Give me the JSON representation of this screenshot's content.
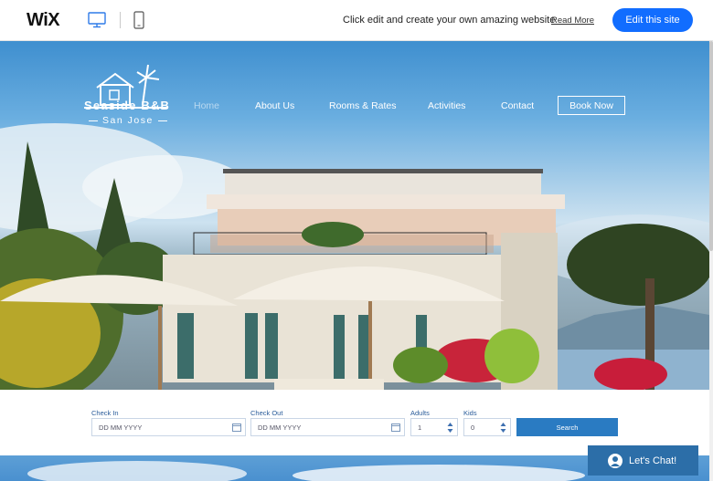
{
  "editor_bar": {
    "logo": "WiX",
    "promo_text": "Click edit and create your own amazing website",
    "read_more": "Read More",
    "edit_button": "Edit this site",
    "devices": [
      "desktop-icon",
      "mobile-icon"
    ]
  },
  "site": {
    "name": "Seaside B&B",
    "subtitle": "San Jose",
    "nav": [
      {
        "label": "Home",
        "active": true
      },
      {
        "label": "About Us",
        "active": false
      },
      {
        "label": "Rooms & Rates",
        "active": false
      },
      {
        "label": "Activities",
        "active": false
      },
      {
        "label": "Contact",
        "active": false
      }
    ],
    "book_now": "Book Now"
  },
  "booking": {
    "check_in_label": "Check In",
    "check_in_placeholder": "DD MM YYYY",
    "check_out_label": "Check Out",
    "check_out_placeholder": "DD MM YYYY",
    "adults_label": "Adults",
    "adults_value": "1",
    "kids_label": "Kids",
    "kids_value": "0",
    "search_button": "Search"
  },
  "chat": {
    "label": "Let's Chat!"
  },
  "colors": {
    "wix_blue": "#116dff",
    "search_blue": "#2a7bc2",
    "chat_blue": "#2c6ea8"
  }
}
